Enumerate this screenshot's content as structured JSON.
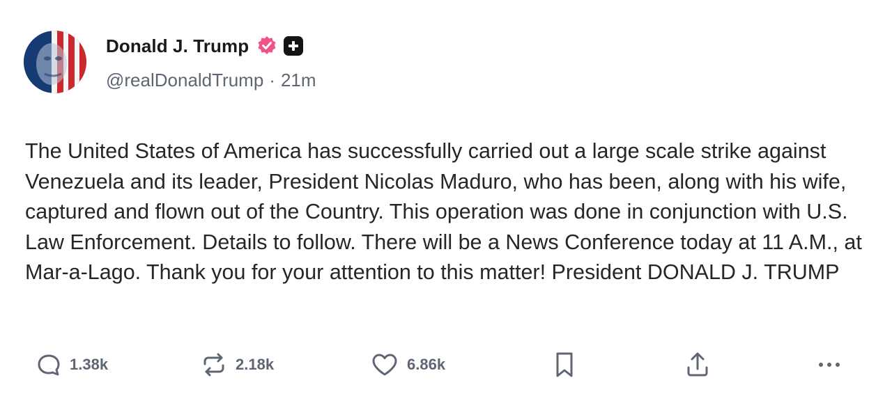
{
  "author": {
    "display_name": "Donald J. Trump",
    "handle": "@realDonaldTrump",
    "separator": "·",
    "time_ago": "21m",
    "verified_color": "#f0528a"
  },
  "post": {
    "text": "The United States of America has successfully carried out a large scale strike against Venezuela and its leader, President Nicolas Maduro, who has been, along with his wife, captured and flown out of the Country. This operation was done in conjunction with U.S. Law Enforcement. Details to follow. There will be a News Conference today at 11 A.M., at Mar-a-Lago. Thank you for your attention to this matter! President DONALD J. TRUMP"
  },
  "actions": {
    "reply": {
      "icon": "reply-icon",
      "count": "1.38k"
    },
    "repost": {
      "icon": "repost-icon",
      "count": "2.18k"
    },
    "like": {
      "icon": "heart-icon",
      "count": "6.86k"
    },
    "bookmark": {
      "icon": "bookmark-icon"
    },
    "share": {
      "icon": "share-icon"
    },
    "more": {
      "icon": "more-icon"
    }
  }
}
